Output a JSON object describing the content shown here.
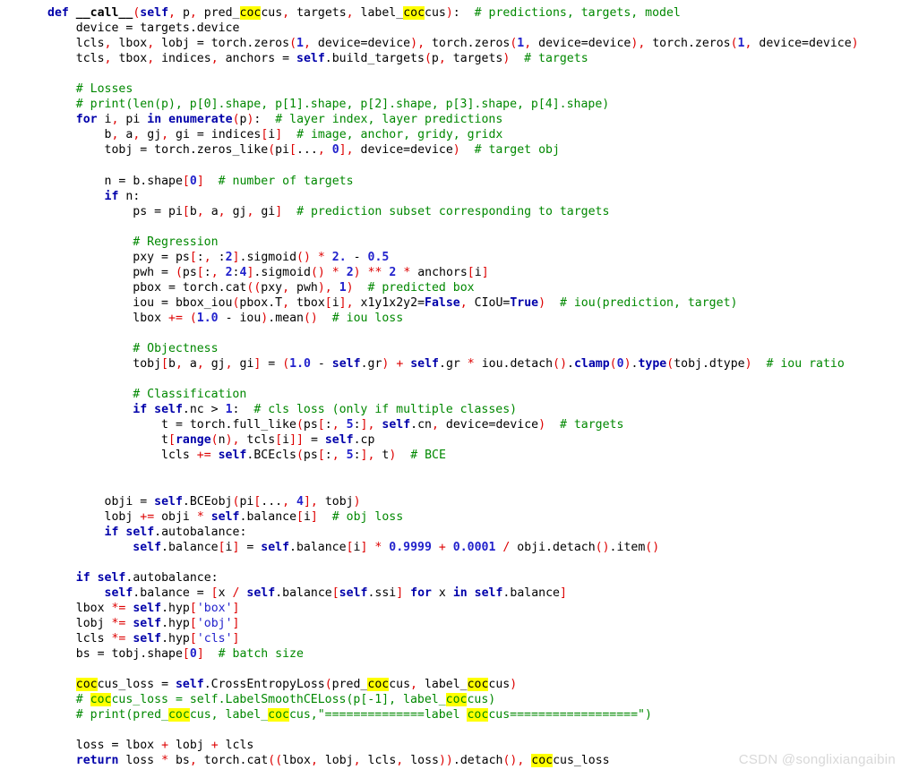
{
  "editor": {
    "language": "python",
    "background_color": "#ffffff",
    "font_size_px": 13,
    "search_term": "coc",
    "highlight_color": "#ffff00",
    "colors": {
      "keyword": "#0000aa",
      "comment": "#008800",
      "punctuation": "#dd0000",
      "operator": "#dd0000",
      "number": "#2222cc",
      "string": "#2222cc",
      "plain": "#000000"
    }
  },
  "watermark": {
    "text": "CSDN @songlixiangaibin"
  },
  "code": {
    "full_text": "def __call__(self, p, pred_coccus, targets, label_coccus):  # predictions, targets, model\n    device = targets.device\n    lcls, lbox, lobj = torch.zeros(1, device=device), torch.zeros(1, device=device), torch.zeros(1, device=device)\n    tcls, tbox, indices, anchors = self.build_targets(p, targets)  # targets\n\n    # Losses\n    # print(len(p), p[0].shape, p[1].shape, p[2].shape, p[3].shape, p[4].shape)\n    for i, pi in enumerate(p):  # layer index, layer predictions\n        b, a, gj, gi = indices[i]  # image, anchor, gridy, gridx\n        tobj = torch.zeros_like(pi[..., 0], device=device)  # target obj\n\n        n = b.shape[0]  # number of targets\n        if n:\n            ps = pi[b, a, gj, gi]  # prediction subset corresponding to targets\n\n            # Regression\n            pxy = ps[:, :2].sigmoid() * 2. - 0.5\n            pwh = (ps[:, 2:4].sigmoid() * 2) ** 2 * anchors[i]\n            pbox = torch.cat((pxy, pwh), 1)  # predicted box\n            iou = bbox_iou(pbox.T, tbox[i], x1y1x2y2=False, CIoU=True)  # iou(prediction, target)\n            lbox += (1.0 - iou).mean()  # iou loss\n\n            # Objectness\n            tobj[b, a, gj, gi] = (1.0 - self.gr) + self.gr * iou.detach().clamp(0).type(tobj.dtype)  # iou ratio\n\n            # Classification\n            if self.nc > 1:  # cls loss (only if multiple classes)\n                t = torch.full_like(ps[:, 5:], self.cn, device=device)  # targets\n                t[range(n), tcls[i]] = self.cp\n                lcls += self.BCEcls(ps[:, 5:], t)  # BCE\n\n\n        obji = self.BCEobj(pi[..., 4], tobj)\n        lobj += obji * self.balance[i]  # obj loss\n        if self.autobalance:\n            self.balance[i] = self.balance[i] * 0.9999 + 0.0001 / obji.detach().item()\n\n    if self.autobalance:\n        self.balance = [x / self.balance[self.ssi] for x in self.balance]\n    lbox *= self.hyp['box']\n    lobj *= self.hyp['obj']\n    lcls *= self.hyp['cls']\n    bs = tobj.shape[0]  # batch size\n\n    coccus_loss = self.CrossEntropyLoss(pred_coccus, label_coccus)\n    # coccus_loss = self.LabelSmoothCELoss(p[-1], label_coccus)\n    # print(pred_coccus, label_coccus,\"==============label coccus==================\")\n\n    loss = lbox + lobj + lcls\n    return loss * bs, torch.cat((lbox, lobj, lcls, loss)).detach(), coccus_loss",
    "lines": [
      "def __call__(self, p, pred_coccus, targets, label_coccus):  # predictions, targets, model",
      "    device = targets.device",
      "    lcls, lbox, lobj = torch.zeros(1, device=device), torch.zeros(1, device=device), torch.zeros(1, device=device)",
      "    tcls, tbox, indices, anchors = self.build_targets(p, targets)  # targets",
      "",
      "    # Losses",
      "    # print(len(p), p[0].shape, p[1].shape, p[2].shape, p[3].shape, p[4].shape)",
      "    for i, pi in enumerate(p):  # layer index, layer predictions",
      "        b, a, gj, gi = indices[i]  # image, anchor, gridy, gridx",
      "        tobj = torch.zeros_like(pi[..., 0], device=device)  # target obj",
      "",
      "        n = b.shape[0]  # number of targets",
      "        if n:",
      "            ps = pi[b, a, gj, gi]  # prediction subset corresponding to targets",
      "",
      "            # Regression",
      "            pxy = ps[:, :2].sigmoid() * 2. - 0.5",
      "            pwh = (ps[:, 2:4].sigmoid() * 2) ** 2 * anchors[i]",
      "            pbox = torch.cat((pxy, pwh), 1)  # predicted box",
      "            iou = bbox_iou(pbox.T, tbox[i], x1y1x2y2=False, CIoU=True)  # iou(prediction, target)",
      "            lbox += (1.0 - iou).mean()  # iou loss",
      "",
      "            # Objectness",
      "            tobj[b, a, gj, gi] = (1.0 - self.gr) + self.gr * iou.detach().clamp(0).type(tobj.dtype)  # iou ratio",
      "",
      "            # Classification",
      "            if self.nc > 1:  # cls loss (only if multiple classes)",
      "                t = torch.full_like(ps[:, 5:], self.cn, device=device)  # targets",
      "                t[range(n), tcls[i]] = self.cp",
      "                lcls += self.BCEcls(ps[:, 5:], t)  # BCE",
      "",
      "",
      "        obji = self.BCEobj(pi[..., 4], tobj)",
      "        lobj += obji * self.balance[i]  # obj loss",
      "        if self.autobalance:",
      "            self.balance[i] = self.balance[i] * 0.9999 + 0.0001 / obji.detach().item()",
      "",
      "    if self.autobalance:",
      "        self.balance = [x / self.balance[self.ssi] for x in self.balance]",
      "    lbox *= self.hyp['box']",
      "    lobj *= self.hyp['obj']",
      "    lcls *= self.hyp['cls']",
      "    bs = tobj.shape[0]  # batch size",
      "",
      "    coccus_loss = self.CrossEntropyLoss(pred_coccus, label_coccus)",
      "    # coccus_loss = self.LabelSmoothCELoss(p[-1], label_coccus)",
      "    # print(pred_coccus, label_coccus,\"==============label coccus==================\")",
      "",
      "    loss = lbox + lobj + lcls",
      "    return loss * bs, torch.cat((lbox, lobj, lcls, loss)).detach(), coccus_loss"
    ]
  }
}
